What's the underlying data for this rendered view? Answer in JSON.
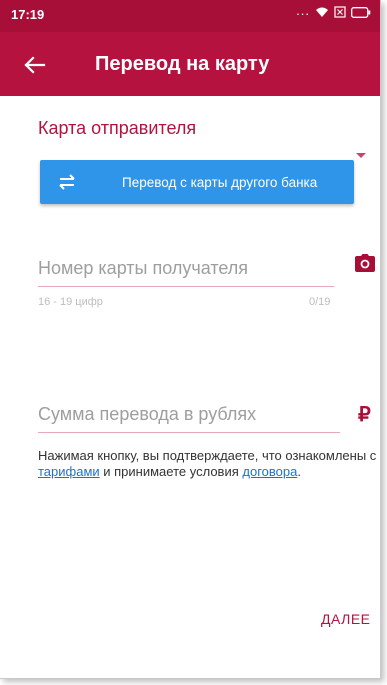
{
  "status_bar": {
    "time": "17:19",
    "icons": [
      "more-dots-icon",
      "wifi-icon",
      "sim-icon",
      "battery-icon"
    ]
  },
  "app_bar": {
    "title": "Перевод на карту",
    "back_icon": "arrow-left-icon"
  },
  "sender": {
    "title": "Карта отправителя",
    "dropdown_icon": "dropdown-arrow-icon"
  },
  "transfer_button": {
    "label": "Перевод с карты другого банка",
    "icon": "swap-arrows-icon"
  },
  "card_number": {
    "placeholder": "Номер карты получателя",
    "value": "",
    "helper": "16 - 19 цифр",
    "counter": "0/19",
    "icon": "camera-icon"
  },
  "amount": {
    "placeholder": "Сумма перевода в рублях",
    "value": "",
    "currency_symbol": "₽"
  },
  "disclaimer": {
    "part1": "Нажимая кнопку, вы подтверждаете, что ознакомлены с",
    "tariffs_link": " тарифами",
    "part2": " и принимаете условия ",
    "contract_link": "договора",
    "end": "."
  },
  "next_button": {
    "label": "ДАЛЕЕ"
  },
  "colors": {
    "status_bar": "#a70f38",
    "app_bar": "#b5123f",
    "accent": "#b5123f",
    "button_blue": "#2f95e8",
    "link": "#1a73c8"
  }
}
